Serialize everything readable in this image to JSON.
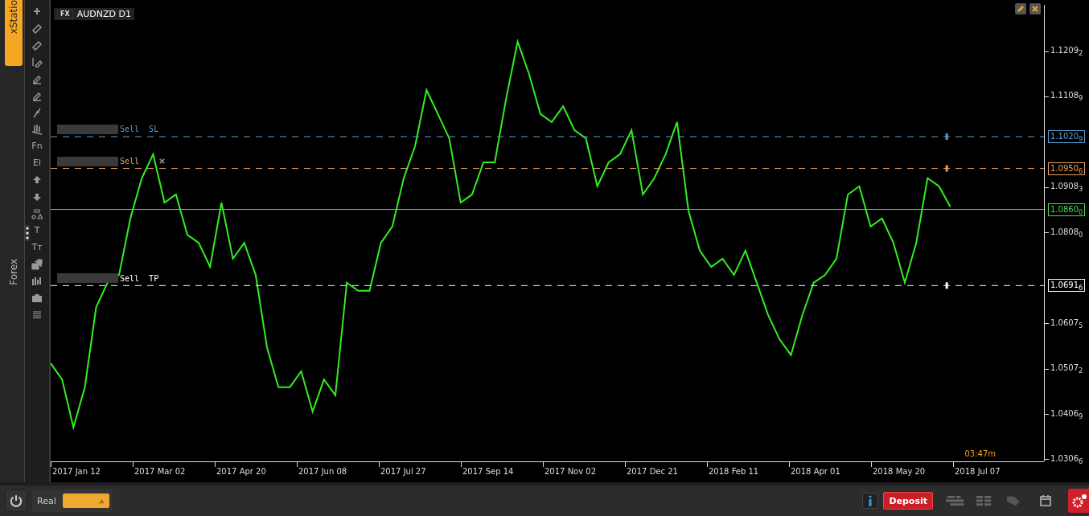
{
  "sidebar": {
    "tabs": [
      {
        "label": "xStatio",
        "selected": true
      },
      {
        "label": "Forex",
        "selected": false
      }
    ]
  },
  "toolbar": [
    {
      "kind": "plus"
    },
    {
      "kind": "ruler"
    },
    {
      "kind": "ruler2"
    },
    {
      "kind": "pen-line"
    },
    {
      "kind": "pen"
    },
    {
      "kind": "pen"
    },
    {
      "kind": "feather"
    },
    {
      "kind": "bars"
    },
    {
      "kind": "text",
      "label": "Fn"
    },
    {
      "kind": "text",
      "label": "El"
    },
    {
      "kind": "up"
    },
    {
      "kind": "down"
    },
    {
      "kind": "shapes"
    },
    {
      "kind": "text",
      "label": "T"
    },
    {
      "kind": "text",
      "label": "Tт"
    },
    {
      "kind": "layers"
    },
    {
      "kind": "candles"
    },
    {
      "kind": "camera"
    },
    {
      "kind": "list"
    }
  ],
  "chart": {
    "badge": "FX",
    "symbol": "AUDNZD D1",
    "timer": "03:47m",
    "levels": [
      {
        "kind": "dashed",
        "label": "Sell  SL",
        "closable": false,
        "tag": "1.1020$_{9}$",
        "color": "#5a9fd4"
      },
      {
        "kind": "dashed",
        "label": "Sell",
        "closable": true,
        "tag": "1.0950$_{6}$",
        "color": "#e8a060"
      },
      {
        "kind": "solid",
        "tag": "1.0860$_{0}$",
        "color": "#44dd44"
      },
      {
        "kind": "dashed",
        "label": "Sell  TP",
        "closable": false,
        "tag": "1.0691$_{6}$",
        "color": "#ffffff"
      }
    ],
    "x_axis_labels": [
      "2017 Jan 12",
      "2017 Mar 02",
      "2017 Apr 20",
      "2017 Jun 08",
      "2017 Jul 27",
      "2017 Sep 14",
      "2017 Nov 02",
      "2017 Dec 21",
      "2018 Feb 11",
      "2018 Apr 01",
      "2018 May 20",
      "2018 Jul 07"
    ],
    "y_axis_labels": [
      "1.1209$_{2}$",
      "1.1108$_{9}$",
      "1.0908$_{3}$",
      "1.0808$_{0}$",
      "1.0607$_{5}$",
      "1.0507$_{2}$",
      "1.0406$_{9}$",
      "1.0306$_{6}$"
    ]
  },
  "bottom_bar": {
    "account_label": "Real",
    "deposit": "Deposit"
  }
}
